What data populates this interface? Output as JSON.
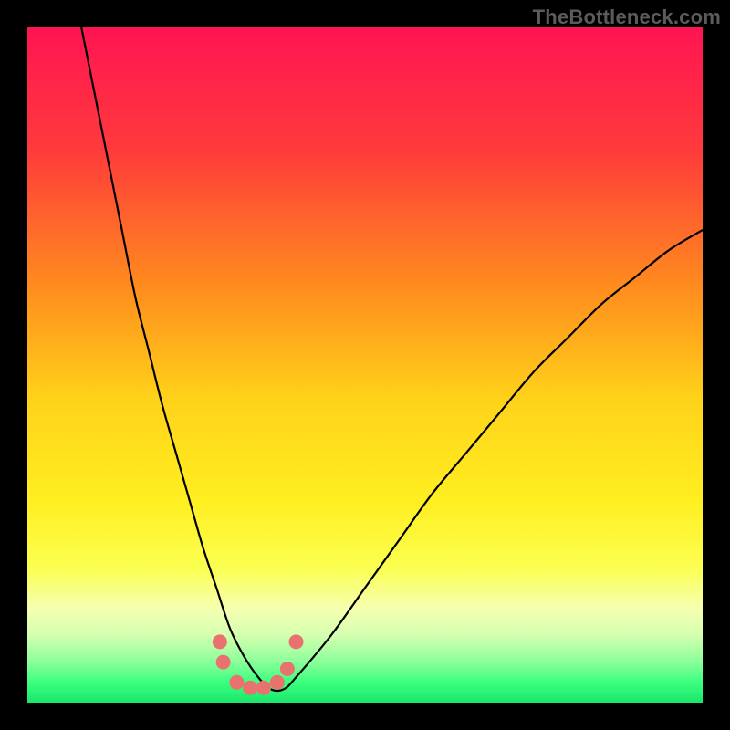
{
  "watermark": "TheBottleneck.com",
  "chart_data": {
    "type": "line",
    "title": "",
    "xlabel": "",
    "ylabel": "",
    "xlim": [
      0,
      100
    ],
    "ylim": [
      0,
      100
    ],
    "grid": false,
    "legend": false,
    "background": {
      "type": "vertical-gradient",
      "stops": [
        {
          "pos": 0.0,
          "color": "#ff1452"
        },
        {
          "pos": 0.18,
          "color": "#ff3a3c"
        },
        {
          "pos": 0.38,
          "color": "#ff8a1e"
        },
        {
          "pos": 0.55,
          "color": "#ffd21a"
        },
        {
          "pos": 0.7,
          "color": "#ffee20"
        },
        {
          "pos": 0.8,
          "color": "#fbff50"
        },
        {
          "pos": 0.86,
          "color": "#f6ffb0"
        },
        {
          "pos": 0.9,
          "color": "#d5ffb0"
        },
        {
          "pos": 0.94,
          "color": "#8aff9a"
        },
        {
          "pos": 0.97,
          "color": "#3bff7e"
        },
        {
          "pos": 1.0,
          "color": "#18e66b"
        }
      ]
    },
    "series": [
      {
        "name": "bottleneck-curve",
        "stroke": "#000000",
        "stroke_width": 2.2,
        "x": [
          8,
          10,
          12,
          14,
          16,
          18,
          20,
          22,
          24,
          26,
          28,
          30,
          32,
          34,
          36,
          38,
          40,
          45,
          50,
          55,
          60,
          65,
          70,
          75,
          80,
          85,
          90,
          95,
          100
        ],
        "y": [
          100,
          90,
          80,
          70,
          60,
          52,
          44,
          37,
          30,
          23,
          17,
          11,
          7,
          4,
          2,
          2,
          4,
          10,
          17,
          24,
          31,
          37,
          43,
          49,
          54,
          59,
          63,
          67,
          70
        ]
      },
      {
        "name": "marker-dots",
        "type": "scatter",
        "color": "#e9726f",
        "radius": 8,
        "x": [
          28.5,
          29.0,
          31.0,
          33.0,
          35.0,
          37.0,
          38.5,
          39.8
        ],
        "y": [
          9.0,
          6.0,
          3.0,
          2.2,
          2.2,
          3.0,
          5.0,
          9.0
        ]
      }
    ]
  }
}
